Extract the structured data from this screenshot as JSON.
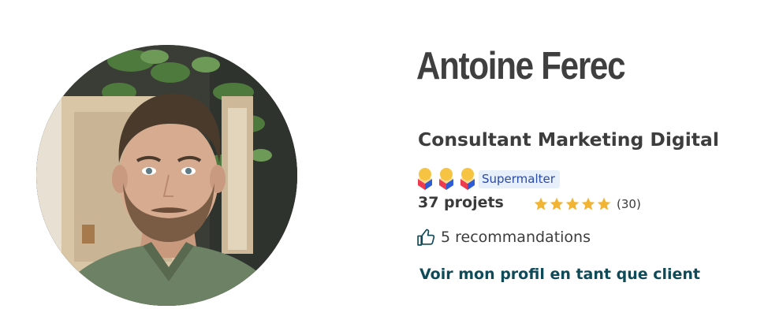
{
  "profile": {
    "name": "Antoine Ferec",
    "title": "Consultant Marketing Digital",
    "badge_label": "Supermalter",
    "medals": [
      "medal-icon",
      "medal-icon",
      "medal-icon"
    ],
    "projects": "37 projets",
    "rating": 5,
    "rating_max": 5,
    "review_count": "(30)",
    "recommendations": "5 recommandations",
    "client_link": "Voir mon profil en tant que client"
  },
  "colors": {
    "name": "#3f3f3f",
    "badge_bg": "#e7effb",
    "badge_text": "#2a4aa8",
    "star": "#f2b533",
    "link": "#0e4a58",
    "medal_gold": "#f6c343",
    "medal_red": "#ef3b4f",
    "medal_blue": "#2e5bd6"
  },
  "icons": {
    "thumb": "thumbs-up-icon",
    "star": "star-icon",
    "medal": "medal-icon"
  }
}
